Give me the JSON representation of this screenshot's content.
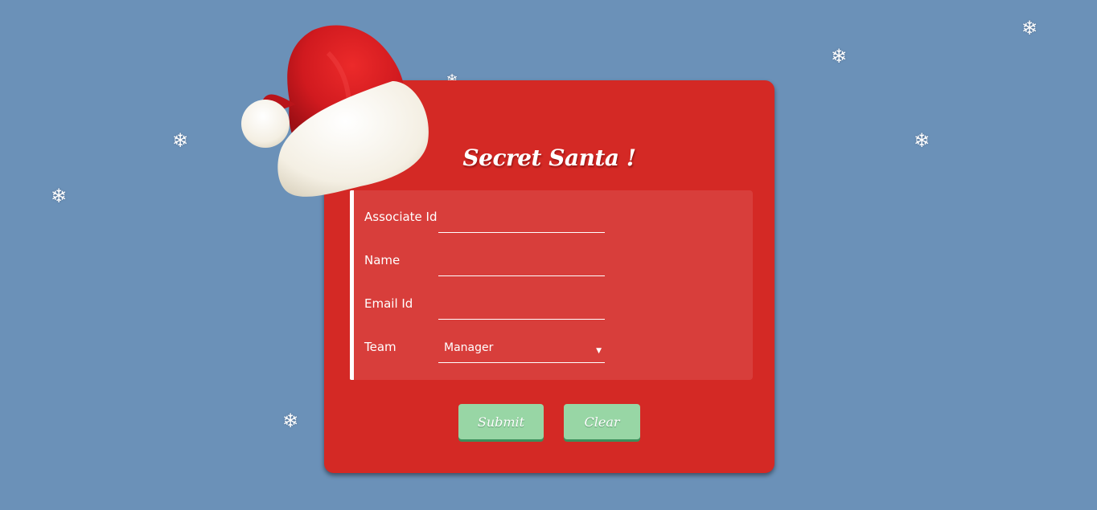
{
  "app": {
    "title": "Secret Santa !"
  },
  "form": {
    "fields": [
      {
        "label": "Associate Id",
        "value": ""
      },
      {
        "label": "Name",
        "value": ""
      },
      {
        "label": "Email Id",
        "value": ""
      }
    ],
    "team": {
      "label": "Team",
      "selected": "Manager"
    }
  },
  "buttons": {
    "submit": "Submit",
    "clear": "Clear"
  },
  "decor": {
    "snowflake_glyph": "❄",
    "hat_icon": "santa-hat-icon"
  },
  "colors": {
    "background": "#6b91b8",
    "card": "#d42925",
    "button": "#98d6a5",
    "button_shadow": "#3c8f5b"
  }
}
